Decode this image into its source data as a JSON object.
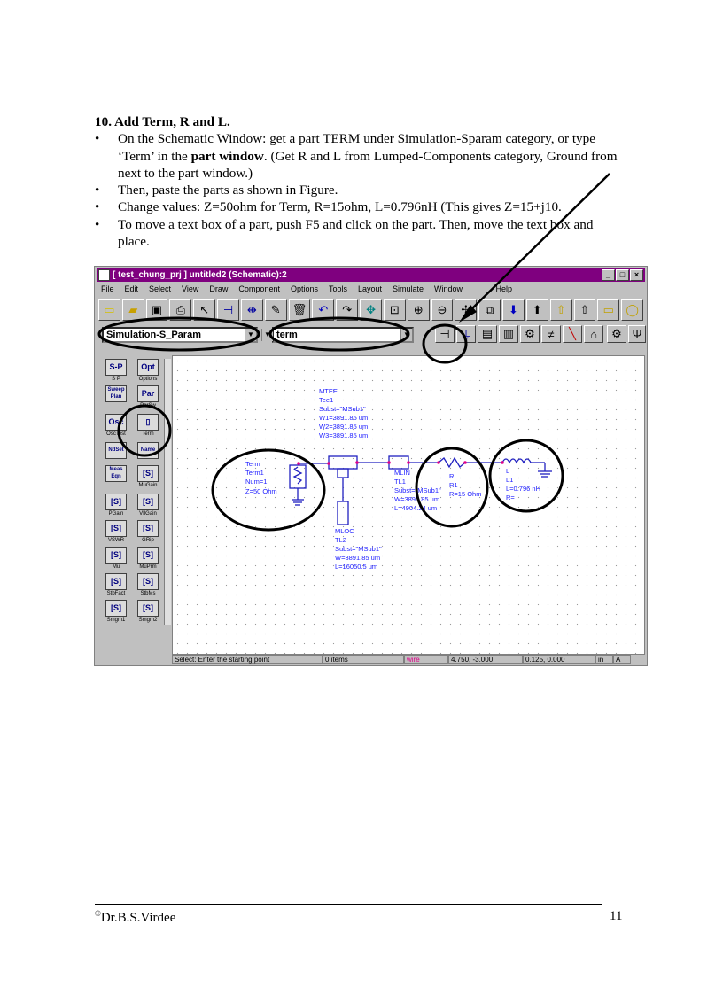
{
  "doc": {
    "heading": "10. Add Term, R and L.",
    "bullets": [
      {
        "pre": "On the Schematic Window: get a part TERM under Simulation-Sparam category, or type ‘Term’ in the ",
        "bold": "part window",
        "post": ".  (Get R and L from Lumped-Components category, Ground from next to the part window.)"
      },
      {
        "pre": "Then, paste the parts as shown in Figure.",
        "bold": "",
        "post": ""
      },
      {
        "pre": "Change values: Z=50ohm for Term, R=15ohm, L=0.796nH (This gives Z=15+j10.",
        "bold": "",
        "post": ""
      },
      {
        "pre": "To move a text box of a part, push F5 and click on the part. Then, move the text box and place.",
        "bold": "",
        "post": ""
      }
    ],
    "bullet_glyph": "•"
  },
  "window": {
    "title": "[ test_chung_prj ] untitled2 (Schematic):2",
    "menu": [
      "File",
      "Edit",
      "Select",
      "View",
      "Draw",
      "Component",
      "Options",
      "Tools",
      "Layout",
      "Simulate",
      "Window",
      "Help"
    ],
    "category_value": "Simulation-S_Param",
    "part_value": "term",
    "palette": [
      {
        "glyph": "S-P",
        "label": "S P"
      },
      {
        "glyph": "Opt",
        "label": "Options"
      },
      {
        "glyph": "Sweep Plan",
        "label": ""
      },
      {
        "glyph": "Par",
        "label": "ParSw"
      },
      {
        "glyph": "Osc",
        "label": "OscTest"
      },
      {
        "glyph": "▯",
        "label": "Term"
      },
      {
        "glyph": "NdSet",
        "label": ""
      },
      {
        "glyph": "Name",
        "label": ""
      },
      {
        "glyph": "Meas Eqn",
        "label": ""
      },
      {
        "glyph": "[S]",
        "label": "MuGain"
      },
      {
        "glyph": "[S]",
        "label": "PGain"
      },
      {
        "glyph": "[S]",
        "label": "VIlGain"
      },
      {
        "glyph": "[S]",
        "label": "VSWR"
      },
      {
        "glyph": "[S]",
        "label": "GRip"
      },
      {
        "glyph": "[S]",
        "label": "Mu"
      },
      {
        "glyph": "[S]",
        "label": "MuPrm"
      },
      {
        "glyph": "[S]",
        "label": "StbFact"
      },
      {
        "glyph": "[S]",
        "label": "StbMs"
      },
      {
        "glyph": "[S]",
        "label": "Smgm1"
      },
      {
        "glyph": "[S]",
        "label": "Smgm2"
      }
    ],
    "components": {
      "mtee": [
        "MTEE",
        "Tee1",
        "Subst=\"MSub1\"",
        "W1=3891.85 um",
        "W2=3891.85 um",
        "W3=3891.85 um"
      ],
      "term": [
        "Term",
        "Term1",
        "Num=1",
        "Z=50 Ohm"
      ],
      "mlin": [
        "MLIN",
        "TL1",
        "Subst=\"MSub1\"",
        "W=3891.85 um",
        "L=4904.24 um"
      ],
      "res": [
        "R",
        "R1",
        "R=15 Ohm"
      ],
      "ind": [
        "L",
        "L1",
        "L=0.796 nH",
        "R="
      ],
      "mloc": [
        "MLOC",
        "TL2",
        "Subst=\"MSub1\"",
        "W=3891.85 um",
        "L=16050.5 um"
      ]
    },
    "status": {
      "prompt": "Select: Enter the starting point",
      "items": "0 items",
      "mode": "wire",
      "coord1": "4.750, -3.000",
      "coord2": "0.125, 0.000",
      "unit": "in",
      "flag": "A"
    }
  },
  "footer": {
    "copyright": "©",
    "author": "Dr.B.S.Virdee",
    "page": "11"
  }
}
